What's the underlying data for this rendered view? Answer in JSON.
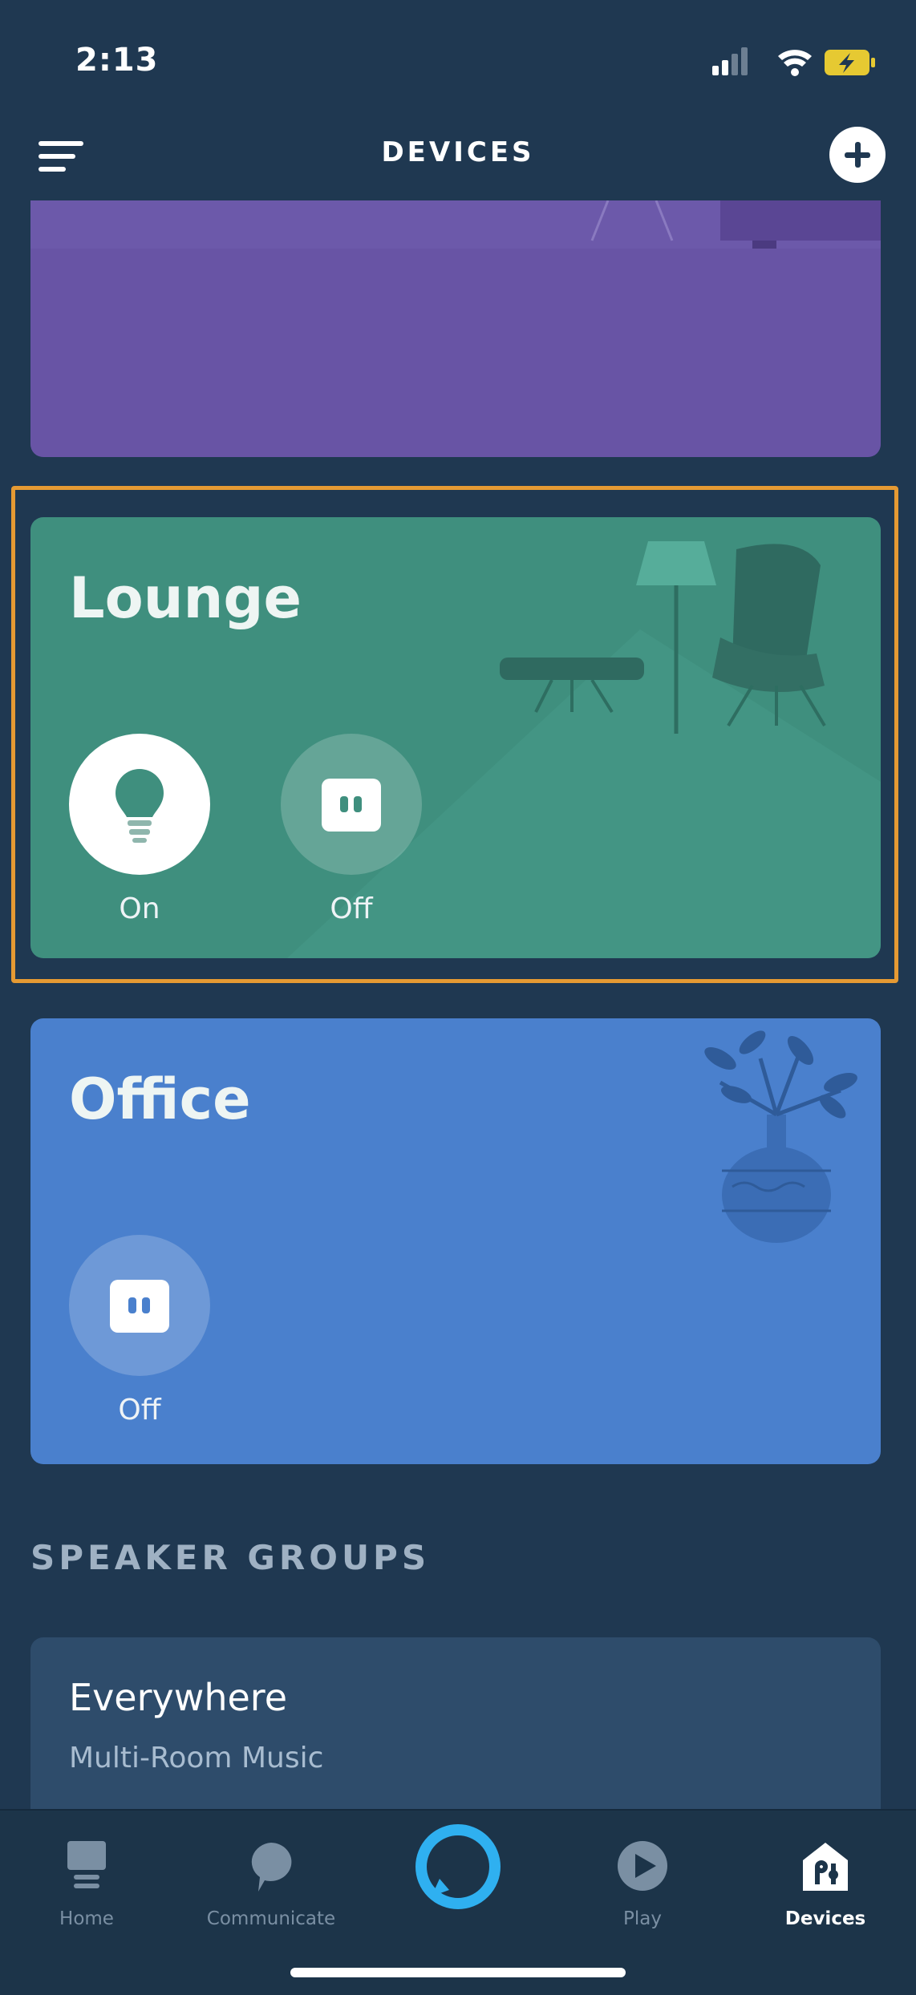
{
  "status_bar": {
    "time": "2:13"
  },
  "header": {
    "title": "DEVICES"
  },
  "rooms": [
    {
      "name": "Lounge",
      "devices": [
        {
          "label": "On",
          "icon": "light-bulb-icon",
          "state": "on"
        },
        {
          "label": "Off",
          "icon": "smart-plug-icon",
          "state": "off"
        }
      ]
    },
    {
      "name": "Office",
      "devices": [
        {
          "label": "Off",
          "icon": "smart-plug-icon",
          "state": "off"
        }
      ]
    }
  ],
  "speaker_groups": {
    "title": "SPEAKER GROUPS",
    "items": [
      {
        "name": "Everywhere",
        "subtitle": "Multi-Room Music"
      }
    ]
  },
  "nav": {
    "items": [
      {
        "label": "Home",
        "icon": "home-icon"
      },
      {
        "label": "Communicate",
        "icon": "chat-bubble-icon"
      },
      {
        "label": "",
        "icon": "alexa-ring-icon"
      },
      {
        "label": "Play",
        "icon": "play-icon"
      },
      {
        "label": "Devices",
        "icon": "devices-icon",
        "active": true
      }
    ]
  },
  "colors": {
    "background": "#1f3851",
    "lounge_card": "#3f8f7e",
    "office_card": "#4a80cd",
    "top_card": "#6c59aa",
    "highlight": "#e59a33",
    "alexa_accent": "#2fb0f0"
  }
}
